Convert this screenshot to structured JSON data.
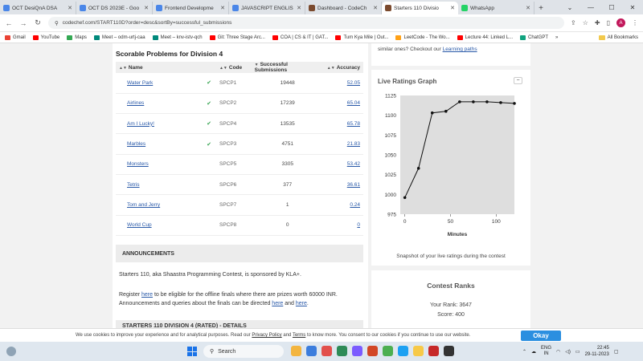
{
  "browser": {
    "tabs": [
      {
        "label": "OCT DesiQnA DSA",
        "color": "#4a86e8",
        "active": false
      },
      {
        "label": "OCT DS 2023E - Goo",
        "color": "#4a86e8",
        "active": false
      },
      {
        "label": "Frontend Developme",
        "color": "#4a86e8",
        "active": false
      },
      {
        "label": "JAVASCRIPT ENGLIS",
        "color": "#4a86e8",
        "active": false
      },
      {
        "label": "Dashboard - CodeCh",
        "color": "#7b4a2e",
        "active": false
      },
      {
        "label": "Starters 110 Divisio",
        "color": "#7b4a2e",
        "active": true
      },
      {
        "label": "WhatsApp",
        "color": "#25d366",
        "active": false
      }
    ],
    "url": "codechef.com/START110D?order=desc&sortBy=successful_submissions",
    "profile_initial": "A",
    "bookmarks": [
      {
        "label": "Gmail",
        "color": "#ea4335"
      },
      {
        "label": "YouTube",
        "color": "#ff0000"
      },
      {
        "label": "Maps",
        "color": "#34a853"
      },
      {
        "label": "Meet – odm-urtj-caa",
        "color": "#00897b"
      },
      {
        "label": "Meet – knv-istv-qch",
        "color": "#00897b"
      },
      {
        "label": "Git: Three Stage Arc...",
        "color": "#ff0000"
      },
      {
        "label": "COA | CS & IT | GAT...",
        "color": "#ff0000"
      },
      {
        "label": "Tum Kya Mile | Out...",
        "color": "#ff0000"
      },
      {
        "label": "LeetCode - The Wo...",
        "color": "#ffa116"
      },
      {
        "label": "Lecture 44: Linked L...",
        "color": "#ff0000"
      },
      {
        "label": "ChatGPT",
        "color": "#10a37f"
      }
    ],
    "more_bookmarks": "»",
    "all_bookmarks": "All Bookmarks"
  },
  "problems": {
    "title": "Scorable Problems for Division 4",
    "columns": {
      "name": "Name",
      "code": "Code",
      "subs": "Successful Submissions",
      "acc": "Accuracy"
    },
    "rows": [
      {
        "name": "Water Park",
        "solved": "✔",
        "code": "SPCP1",
        "subs": "19448",
        "acc": "52.05"
      },
      {
        "name": "Airlines",
        "solved": "✔",
        "code": "SPCP2",
        "subs": "17239",
        "acc": "65.04"
      },
      {
        "name": "Am I Lucky!",
        "solved": "✔",
        "code": "SPCP4",
        "subs": "13535",
        "acc": "65.78"
      },
      {
        "name": "Marbles",
        "solved": "✔",
        "code": "SPCP3",
        "subs": "4751",
        "acc": "21.83"
      },
      {
        "name": "Monsters",
        "solved": "",
        "code": "SPCP5",
        "subs": "3305",
        "acc": "53.42"
      },
      {
        "name": "Tetris",
        "solved": "",
        "code": "SPCP6",
        "subs": "377",
        "acc": "36.61"
      },
      {
        "name": "Tom and Jerry",
        "solved": "",
        "code": "SPCP7",
        "subs": "1",
        "acc": "0.24"
      },
      {
        "name": "World Cup",
        "solved": "",
        "code": "SPCP8",
        "subs": "0",
        "acc": "0"
      }
    ]
  },
  "announcements": {
    "heading": "ANNOUNCEMENTS",
    "line1": "Starters 110, aka Shaastra Programming Contest, is sponsored by KLA+.",
    "register_pre": "Register ",
    "register_link": "here",
    "register_post": " to be eligible for the offline finals where there are prizes worth 60000 INR.",
    "queries_pre": "Announcements and queries about the finals can be directed ",
    "queries_link1": "here",
    "queries_mid": " and ",
    "queries_link2": "here",
    "queries_post": ".",
    "details_heading": "STARTERS 110 DIVISION 4 (RATED) - DETAILS"
  },
  "sidebar": {
    "top_text": "similar ones? Checkout our ",
    "top_link": "Learning paths",
    "graph_title": "Live Ratings Graph",
    "collapse": "−",
    "graph_caption": "Snapshot of your live ratings during the contest",
    "rank_title": "Contest Ranks",
    "your_rank": "Your Rank: 3647",
    "score": "Score: 400"
  },
  "chart_data": {
    "type": "line",
    "x": [
      0,
      15,
      30,
      45,
      60,
      75,
      90,
      105,
      120
    ],
    "y": [
      996,
      1033,
      1103,
      1105,
      1117,
      1117,
      1117,
      1116,
      1115
    ],
    "xlabel": "Minutes",
    "ylabel": "",
    "xlim": [
      -5,
      120
    ],
    "ylim": [
      975,
      1125
    ],
    "xticks": [
      0,
      50,
      100
    ],
    "yticks": [
      975,
      1000,
      1025,
      1050,
      1075,
      1100,
      1125
    ],
    "plot_bg": "#dedede",
    "line_color": "#111111"
  },
  "cookie": {
    "text_pre": "We use cookies to improve your experience and for analytical purposes. Read our ",
    "privacy": "Privacy Policy",
    "and": " and ",
    "terms": "Terms",
    "text_post": " to know more. You consent to our cookies if you continue to use our website.",
    "ok": "Okay"
  },
  "taskbar": {
    "search": "Search",
    "lang1": "ENG",
    "lang2": "IN",
    "time": "22:45",
    "date": "29-11-2023",
    "app_colors": [
      "#f3b53f",
      "#3b7ddd",
      "#e2504c",
      "#2e8b57",
      "#7b5cff",
      "#d24726",
      "#4caf50",
      "#1da1f2",
      "#f7c948",
      "#c62828",
      "#333333"
    ]
  }
}
